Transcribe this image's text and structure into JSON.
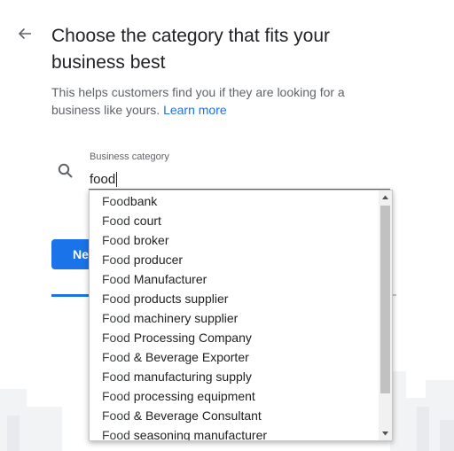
{
  "page": {
    "title": "Choose the category that fits your business best",
    "subtitle": "This helps customers find you if they are looking for a business like yours.",
    "learn_more": "Learn more"
  },
  "field": {
    "label": "Business category",
    "value": "food"
  },
  "next_button": {
    "label": "Next"
  },
  "icons": {
    "back": "arrow-back-icon",
    "search": "search-icon",
    "scroll_up": "scroll-up-arrow-icon",
    "scroll_down": "scroll-down-arrow-icon"
  },
  "colors": {
    "accent": "#1a73e8",
    "text": "#202124",
    "secondary_text": "#5f6368"
  },
  "dropdown": {
    "options": [
      {
        "match": "Food",
        "rest": "bank"
      },
      {
        "match": "Food",
        "rest": " court"
      },
      {
        "match": "Food",
        "rest": " broker"
      },
      {
        "match": "Food",
        "rest": " producer"
      },
      {
        "match": "Food",
        "rest": " Manufacturer"
      },
      {
        "match": "Food",
        "rest": " products supplier"
      },
      {
        "match": "Food",
        "rest": " machinery supplier"
      },
      {
        "match": "Food",
        "rest": " Processing Company"
      },
      {
        "match": "Food",
        "rest": " & Beverage Exporter"
      },
      {
        "match": "Food",
        "rest": " manufacturing supply"
      },
      {
        "match": "Food",
        "rest": " processing equipment"
      },
      {
        "match": "Food",
        "rest": " & Beverage Consultant"
      },
      {
        "match": "Food",
        "rest": " seasoning manufacturer"
      }
    ]
  }
}
